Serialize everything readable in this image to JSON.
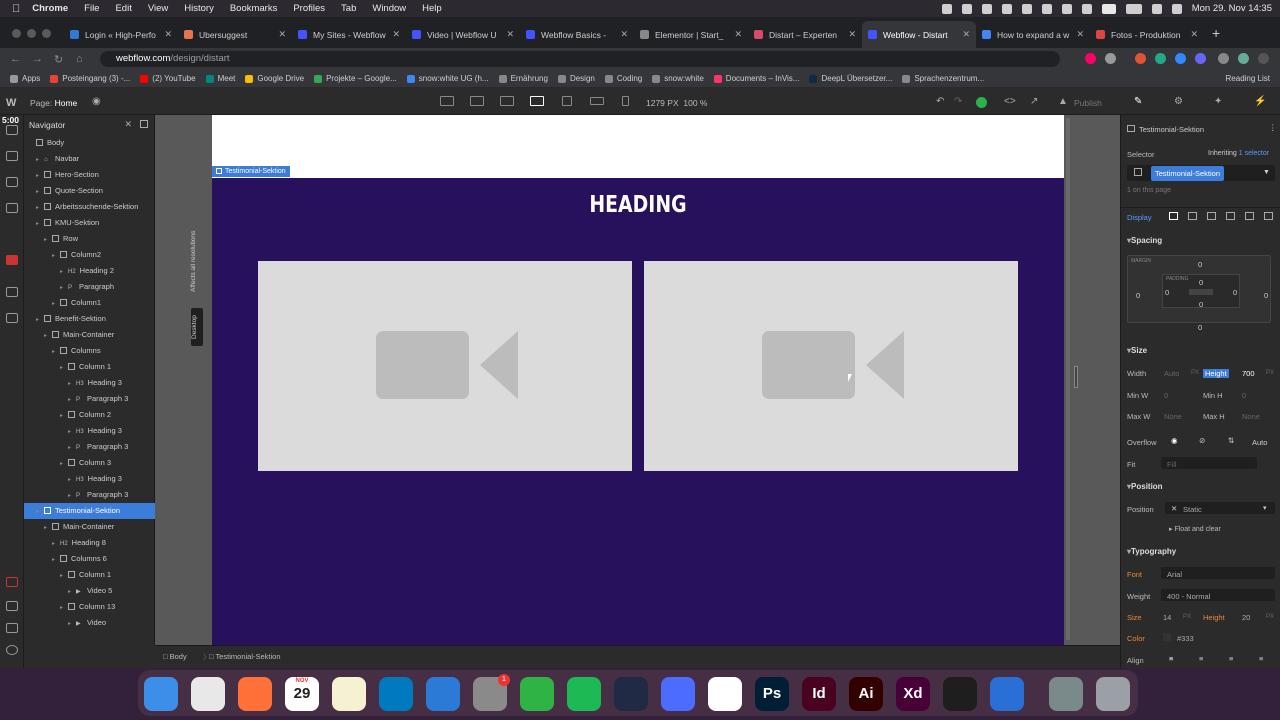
{
  "menubar": {
    "app": "Chrome",
    "items": [
      "File",
      "Edit",
      "View",
      "History",
      "Bookmarks",
      "Profiles",
      "Tab",
      "Window",
      "Help"
    ],
    "clock": "Mon 29. Nov  14:35"
  },
  "tabs": [
    {
      "label": "Login « High-Perfo",
      "color": "#2e7bd6"
    },
    {
      "label": "Ubersuggest",
      "color": "#e8734a"
    },
    {
      "label": "My Sites - Webflow",
      "color": "#4353ff"
    },
    {
      "label": "Video | Webflow U",
      "color": "#4353ff"
    },
    {
      "label": "Webflow Basics - ",
      "color": "#4353ff"
    },
    {
      "label": "Elementor | Start_",
      "color": "#888888"
    },
    {
      "label": "Distart – Experten",
      "color": "#d84a6a"
    },
    {
      "label": "Webflow - Distart",
      "color": "#4353ff",
      "active": true
    },
    {
      "label": "How to expand a w",
      "color": "#4285f4"
    },
    {
      "label": "Fotos - Produktion",
      "color": "#d44"
    }
  ],
  "address": {
    "domain": "webflow.com",
    "path": "/design/distart"
  },
  "bookmarks": [
    {
      "label": "Apps",
      "color": "#999"
    },
    {
      "label": "Posteingang (3) -...",
      "color": "#ea4335"
    },
    {
      "label": "(2) YouTube",
      "color": "#ff0000"
    },
    {
      "label": "Meet",
      "color": "#00897b"
    },
    {
      "label": "Google Drive",
      "color": "#fbbc04"
    },
    {
      "label": "Projekte – Google...",
      "color": "#34a853"
    },
    {
      "label": "snow:white UG (h...",
      "color": "#4285f4"
    },
    {
      "label": "Ernährung",
      "color": "#888"
    },
    {
      "label": "Design",
      "color": "#888"
    },
    {
      "label": "Coding",
      "color": "#888"
    },
    {
      "label": "snow:white",
      "color": "#888"
    },
    {
      "label": "Documents – InVis...",
      "color": "#ff3366"
    },
    {
      "label": "DeepL Übersetzer...",
      "color": "#0f2b46"
    },
    {
      "label": "Sprachenzentrum...",
      "color": "#888"
    }
  ],
  "reading_list": "Reading List",
  "wf": {
    "page_label": "Page:",
    "page_name": "Home",
    "width": "1279 PX",
    "zoom": "100 %",
    "publish": "Publish"
  },
  "timer": "5:00",
  "navigator": {
    "title": "Navigator",
    "items": [
      {
        "label": "Body",
        "depth": 0,
        "tag": "box"
      },
      {
        "label": "Navbar",
        "depth": 1,
        "tag": "nav"
      },
      {
        "label": "Hero-Section",
        "depth": 1,
        "tag": "box"
      },
      {
        "label": "Quote-Section",
        "depth": 1,
        "tag": "box"
      },
      {
        "label": "Arbeitssuchende-Sektion",
        "depth": 1,
        "tag": "box"
      },
      {
        "label": "KMU-Sektion",
        "depth": 1,
        "tag": "box"
      },
      {
        "label": "Row",
        "depth": 2,
        "tag": "box"
      },
      {
        "label": "Column2",
        "depth": 3,
        "tag": "box"
      },
      {
        "label": "Heading 2",
        "depth": 4,
        "tag": "H2"
      },
      {
        "label": "Paragraph",
        "depth": 4,
        "tag": "P"
      },
      {
        "label": "Column1",
        "depth": 3,
        "tag": "box"
      },
      {
        "label": "Benefit-Sektion",
        "depth": 1,
        "tag": "box"
      },
      {
        "label": "Main-Container",
        "depth": 2,
        "tag": "box"
      },
      {
        "label": "Columns",
        "depth": 3,
        "tag": "box"
      },
      {
        "label": "Column 1",
        "depth": 4,
        "tag": "box"
      },
      {
        "label": "Heading 3",
        "depth": 5,
        "tag": "H3"
      },
      {
        "label": "Paragraph 3",
        "depth": 5,
        "tag": "P"
      },
      {
        "label": "Column 2",
        "depth": 4,
        "tag": "box"
      },
      {
        "label": "Heading 3",
        "depth": 5,
        "tag": "H3"
      },
      {
        "label": "Paragraph 3",
        "depth": 5,
        "tag": "P"
      },
      {
        "label": "Column 3",
        "depth": 4,
        "tag": "box"
      },
      {
        "label": "Heading 3",
        "depth": 5,
        "tag": "H3"
      },
      {
        "label": "Paragraph 3",
        "depth": 5,
        "tag": "P"
      },
      {
        "label": "Testimonial-Sektion",
        "depth": 1,
        "tag": "box",
        "selected": true
      },
      {
        "label": "Main-Container",
        "depth": 2,
        "tag": "box"
      },
      {
        "label": "Heading 8",
        "depth": 3,
        "tag": "H2"
      },
      {
        "label": "Columns 6",
        "depth": 3,
        "tag": "box"
      },
      {
        "label": "Column 1",
        "depth": 4,
        "tag": "box"
      },
      {
        "label": "Video 5",
        "depth": 5,
        "tag": "vid"
      },
      {
        "label": "Column 13",
        "depth": 4,
        "tag": "box"
      },
      {
        "label": "Video",
        "depth": 5,
        "tag": "vid"
      }
    ]
  },
  "canvas": {
    "section_label": "Testimonial-Sektion",
    "heading": "HEADING",
    "side_text": "Affects all resolutions",
    "side_badge": "Desktop",
    "section_bg": "#28115c"
  },
  "style_panel": {
    "element": "Testimonial-Sektion",
    "selector_label": "Selector",
    "inheriting": "Inheriting",
    "inheriting_count": "1 selector",
    "selector_chip": "Testimonial-Sektion",
    "on_page": "1 on this page",
    "display_label": "Display",
    "spacing": "Spacing",
    "margin_label": "MARGIN",
    "padding_label": "PADDING",
    "margin_values": [
      "0",
      "0",
      "0",
      "0"
    ],
    "padding_values": [
      "0",
      "0",
      "0",
      "0"
    ],
    "size": "Size",
    "width_label": "Width",
    "width_value": "Auto",
    "height_label": "Height",
    "height_value": "700",
    "unit_px": "PX",
    "minw_label": "Min W",
    "minw_value": "0",
    "minh_label": "Min H",
    "minh_value": "0",
    "maxw_label": "Max W",
    "maxw_value": "None",
    "maxh_label": "Max H",
    "maxh_value": "None",
    "overflow_label": "Overflow",
    "overflow_auto": "Auto",
    "fit_label": "Fit",
    "fit_value": "Fill",
    "position": "Position",
    "position_label": "Position",
    "position_value": "Static",
    "float_clear": "Float and clear",
    "typography": "Typography",
    "font_label": "Font",
    "font_value": "Arial",
    "weight_label": "Weight",
    "weight_value": "400 - Normal",
    "size_label": "Size",
    "size_value": "14",
    "lheight_label": "Height",
    "lheight_value": "20",
    "color_label": "Color",
    "color_value": "#333",
    "align_label": "Align"
  },
  "breadcrumbs": [
    "Body",
    "Testimonial-Sektion"
  ],
  "dock": [
    {
      "name": "Finder",
      "color": "#3d8ee8",
      "letter": ""
    },
    {
      "name": "Chrome",
      "color": "#e8e8e8",
      "letter": ""
    },
    {
      "name": "Firefox",
      "color": "#ff7139",
      "letter": ""
    },
    {
      "name": "Calendar",
      "color": "#ffffff",
      "letter": "29",
      "badge_text": "NOV"
    },
    {
      "name": "Notes",
      "color": "#f6f1d3",
      "letter": ""
    },
    {
      "name": "Trello",
      "color": "#0079bf",
      "letter": ""
    },
    {
      "name": "Todo",
      "color": "#2a7ad6",
      "letter": ""
    },
    {
      "name": "System Preferences",
      "color": "#8a8a8a",
      "letter": "",
      "badge": "1"
    },
    {
      "name": "Numbers",
      "color": "#2fb344",
      "letter": ""
    },
    {
      "name": "Spotify",
      "color": "#1db954",
      "letter": ""
    },
    {
      "name": "Screen",
      "color": "#202a44",
      "letter": ""
    },
    {
      "name": "Asana",
      "color": "#4b6cff",
      "letter": ""
    },
    {
      "name": "Slack",
      "color": "#ffffff",
      "letter": ""
    },
    {
      "name": "Photoshop",
      "color": "#001e36",
      "letter": "Ps"
    },
    {
      "name": "InDesign",
      "color": "#49021f",
      "letter": "Id"
    },
    {
      "name": "Illustrator",
      "color": "#330000",
      "letter": "Ai"
    },
    {
      "name": "XD",
      "color": "#470137",
      "letter": "Xd"
    },
    {
      "name": "Figma",
      "color": "#1e1e1e",
      "letter": ""
    },
    {
      "name": "Bitwarden",
      "color": "#2a6fd6",
      "letter": ""
    },
    {
      "name": "Preview",
      "color": "#7a8a8a",
      "letter": ""
    },
    {
      "name": "Trash",
      "color": "#9aa0a6",
      "letter": ""
    }
  ]
}
